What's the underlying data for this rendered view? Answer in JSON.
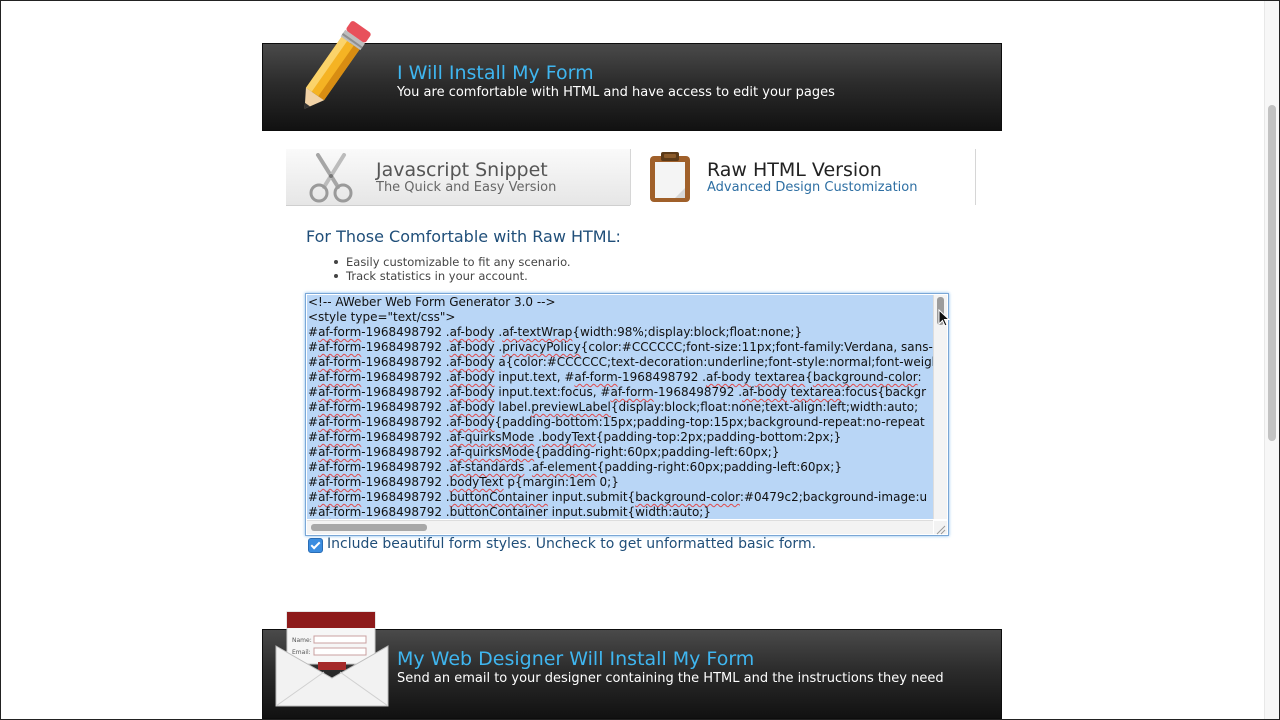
{
  "install_option": {
    "title": "I Will Install My Form",
    "subtitle": "You are comfortable with HTML and have access to edit your pages"
  },
  "tabs": [
    {
      "label": "Javascript Snippet",
      "sublabel": "The Quick and Easy Version",
      "icon": "scissors-icon",
      "active": false
    },
    {
      "label": "Raw HTML Version",
      "sublabel": "Advanced Design Customization",
      "icon": "clipboard-icon",
      "active": true
    }
  ],
  "raw_html": {
    "heading": "For Those Comfortable with Raw HTML:",
    "bullets": [
      "Easily customizable to fit any scenario.",
      "Track statistics in your account."
    ],
    "code_lines": [
      "<!-- AWeber Web Form Generator 3.0 -->",
      "<style type=\"text/css\">",
      "#af-form-1968498792 .af-body .af-textWrap{width:98%;display:block;float:none;}",
      "#af-form-1968498792 .af-body .privacyPolicy{color:#CCCCCC;font-size:11px;font-family:Verdana, sans-",
      "#af-form-1968498792 .af-body a{color:#CCCCCC;text-decoration:underline;font-style:normal;font-weight:",
      "#af-form-1968498792 .af-body input.text, #af-form-1968498792 .af-body textarea{background-color:",
      "#af-form-1968498792 .af-body input.text:focus, #af-form-1968498792 .af-body textarea:focus{backgr",
      "#af-form-1968498792 .af-body label.previewLabel{display:block;float:none;text-align:left;width:auto;",
      "#af-form-1968498792 .af-body{padding-bottom:15px;padding-top:15px;background-repeat:no-repeat",
      "#af-form-1968498792 .af-quirksMode .bodyText{padding-top:2px;padding-bottom:2px;}",
      "#af-form-1968498792 .af-quirksMode{padding-right:60px;padding-left:60px;}",
      "#af-form-1968498792 .af-standards .af-element{padding-right:60px;padding-left:60px;}",
      "#af-form-1968498792 .bodyText p{margin:1em 0;}",
      "#af-form-1968498792 .buttonContainer input.submit{background-color:#0479c2;background-image:u",
      "#af-form-1968498792 .buttonContainer input.submit{width:auto;}"
    ],
    "checkbox_label": "Include beautiful form styles. Uncheck to get unformatted basic form.",
    "checkbox_checked": true
  },
  "designer_option": {
    "title": "My Web Designer Will Install My Form",
    "subtitle": "Send an email to your designer containing the HTML and the instructions they need",
    "envelope_field_labels": [
      "Name:",
      "Email:"
    ]
  },
  "colors": {
    "banner_title": "#3fb6f0",
    "heading": "#1f4e79",
    "selection": "#b9d6f6",
    "link": "#2e6fa3"
  }
}
